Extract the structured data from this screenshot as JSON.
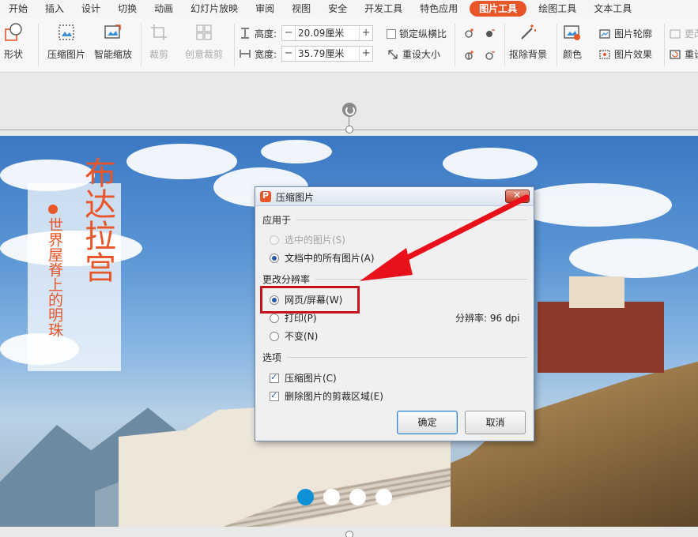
{
  "menu": {
    "tabs": [
      "开始",
      "插入",
      "设计",
      "切换",
      "动画",
      "幻灯片放映",
      "审阅",
      "视图",
      "安全",
      "开发工具",
      "特色应用",
      "图片工具",
      "绘图工具",
      "文本工具"
    ],
    "active_tab": "图片工具"
  },
  "ribbon": {
    "shape": "形状",
    "compress": "压缩图片",
    "smart_zoom": "智能缩放",
    "crop": "裁剪",
    "creative_crop": "创意裁剪",
    "height_label": "高度:",
    "height_value": "20.09厘米",
    "width_label": "宽度:",
    "width_value": "35.79厘米",
    "lock_ratio": "锁定纵横比",
    "reset_size": "重设大小",
    "remove_bg": "抠除背景",
    "color": "颜色",
    "picture_outline": "图片轮廓",
    "picture_effect": "图片效果",
    "more": "更改",
    "reset": "重设",
    "minus": "−",
    "plus": "+"
  },
  "slide": {
    "title": "布达拉宫",
    "subtitle": "世界屋脊上的明珠"
  },
  "dialog": {
    "title": "压缩图片",
    "apply_to_label": "应用于",
    "apply_selected": "选中的图片(S)",
    "apply_all": "文档中的所有图片(A)",
    "resolution_label": "更改分辨率",
    "res_web": "网页/屏幕(W)",
    "res_print": "打印(P)",
    "res_none": "不变(N)",
    "resolution_text": "分辨率:  96 dpi",
    "options_label": "选项",
    "opt_compress": "压缩图片(C)",
    "opt_delete_crop": "删除图片的剪裁区域(E)",
    "ok": "确定",
    "cancel": "取消"
  },
  "colors": {
    "accent": "#e8562a",
    "highlight": "#c4131a",
    "arrow": "#e8101a",
    "dot_active": "#0f91d8"
  }
}
